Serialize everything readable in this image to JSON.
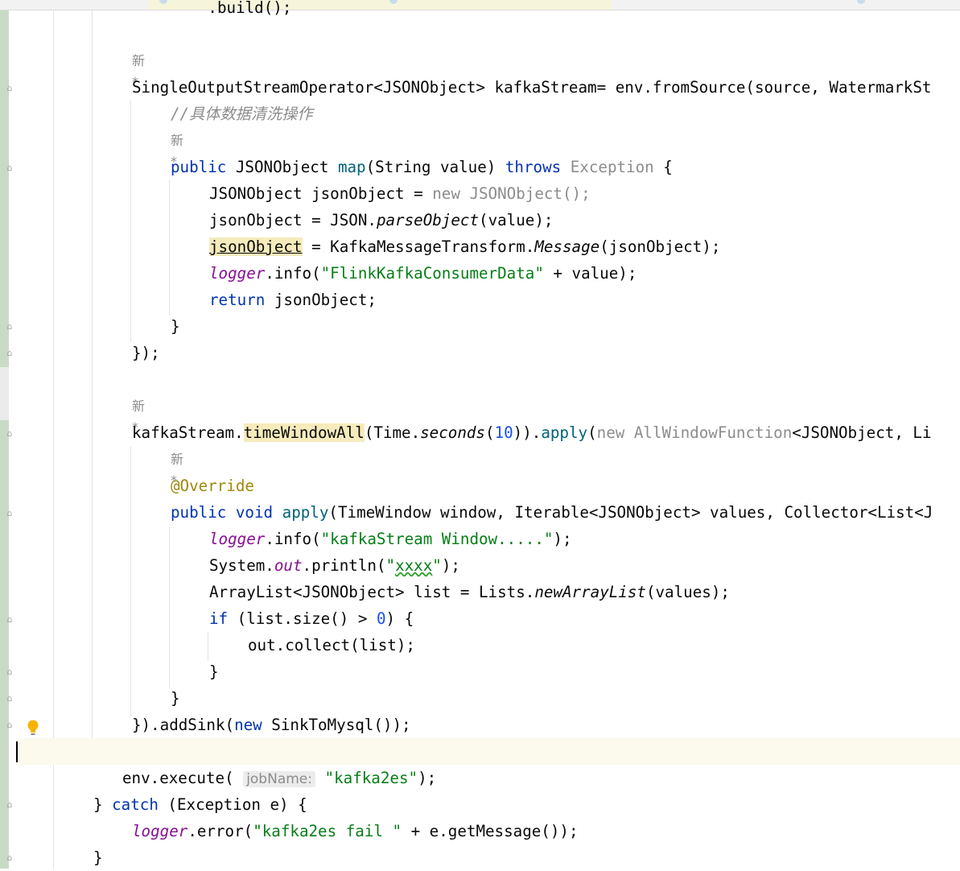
{
  "lines": [
    {
      "t": "        .build();"
    },
    {
      "t": "新 *"
    },
    {
      "t": "SingleOutputStreamOperator<JSONObject> kafkaStream= env.fromSource(source, WatermarkSt"
    },
    {
      "t": "//具体数据清洗操作"
    },
    {
      "t": "新 *"
    },
    {
      "t": "public JSONObject map(String value) throws Exception {"
    },
    {
      "t": "JSONObject jsonObject = new JSONObject();"
    },
    {
      "t": "jsonObject = JSON.parseObject(value);"
    },
    {
      "t": "jsonObject = KafkaMessageTransform.Message(jsonObject);"
    },
    {
      "t": "logger.info(\"FlinkKafkaConsumerData\" + value);"
    },
    {
      "t": "return jsonObject;"
    },
    {
      "t": "}"
    },
    {
      "t": "});"
    },
    {
      "t": "新 *"
    },
    {
      "t": "kafkaStream.timeWindowAll(Time.seconds(10)).apply(new AllWindowFunction<JSONObject, Li"
    },
    {
      "t": "新 *"
    },
    {
      "t": "@Override"
    },
    {
      "t": "public void apply(TimeWindow window, Iterable<JSONObject> values, Collector<List<J"
    },
    {
      "t": "logger.info(\"kafkaStream Window.....\");"
    },
    {
      "t": "System.out.println(\"xxxx\");"
    },
    {
      "t": "ArrayList<JSONObject> list = Lists.newArrayList(values);"
    },
    {
      "t": "if (list.size() > 0) {"
    },
    {
      "t": "out.collect(list);"
    },
    {
      "t": "}"
    },
    {
      "t": "}"
    },
    {
      "t": "}).addSink(new SinkToMysql());"
    },
    {
      "t": "env.execute( jobName: \"kafka2es\");"
    },
    {
      "t": "} catch (Exception e) {"
    },
    {
      "t": "logger.error(\"kafka2es fail \" + e.getMessage());"
    },
    {
      "t": "}"
    }
  ],
  "hints": {
    "author_label": "新 *",
    "job_name_hint": "jobName:"
  },
  "colors": {
    "keyword": "#0033b3",
    "string": "#067d17",
    "number": "#1750eb",
    "comment": "#8c8c8c",
    "field": "#871094",
    "annotation": "#9e880d",
    "gutter": "#c9dbc6",
    "current_line": "#fcfaed"
  },
  "icons": [
    "fold-icon",
    "intention-bulb-icon"
  ]
}
